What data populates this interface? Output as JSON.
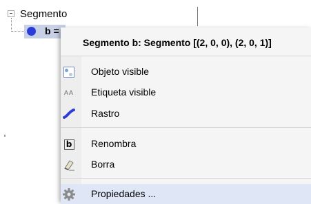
{
  "tree": {
    "root_label": "Segmento",
    "child_label": "b ="
  },
  "menu": {
    "title": "Segmento b: Segmento [(2, 0, 0), (2, 0, 1)]",
    "items": [
      {
        "label": "Objeto visible",
        "icon": "object-visible-icon"
      },
      {
        "label": "Etiqueta visible",
        "icon": "label-visible-icon",
        "icon_text": "AA"
      },
      {
        "label": "Rastro",
        "icon": "trace-icon"
      },
      {
        "label": "Renombra",
        "icon": "rename-icon",
        "icon_text": "b"
      },
      {
        "label": "Borra",
        "icon": "eraser-icon"
      },
      {
        "label": "Propiedades ...",
        "icon": "gear-icon"
      }
    ]
  },
  "colors": {
    "point_blue": "#2a3dd8",
    "selection_bg": "#c8d0e6",
    "hover_bg": "#dfe7f7",
    "menu_bg": "#f5f5f5"
  }
}
